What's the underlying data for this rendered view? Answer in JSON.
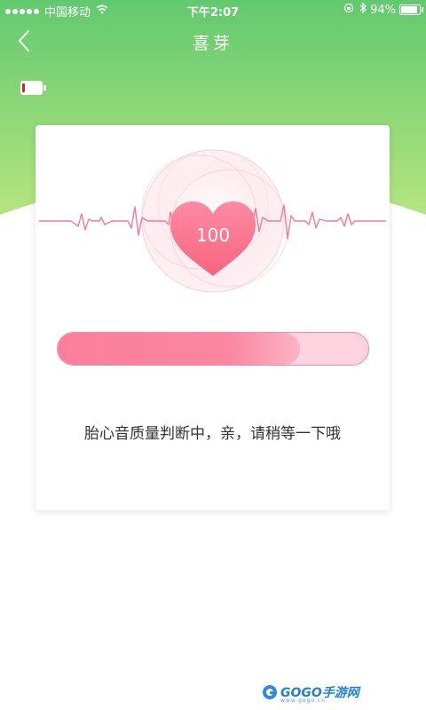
{
  "status_bar": {
    "carrier": "中国移动",
    "time": "下午2:07",
    "battery_percent": "94%",
    "icons": [
      "signal-dots",
      "wifi-icon",
      "rotation-lock-icon",
      "bluetooth-icon",
      "battery-icon"
    ]
  },
  "nav": {
    "back_icon": "chevron-left-icon",
    "title": "喜芽"
  },
  "device": {
    "battery_icon": "battery-low-icon",
    "battery_level_color": "#e2231a"
  },
  "card": {
    "heart_rate": "100",
    "progress_fraction": 0.78,
    "message": "胎心音质量判断中，亲，请稍等一下哦"
  },
  "watermark": {
    "brand": "GOGO手游网",
    "url": "www.gogo.cn"
  },
  "colors": {
    "header_green_top": "#62c96f",
    "header_green_bottom": "#b5e57f",
    "heart_pink": "#f9708f",
    "pulse_line": "#f47a96",
    "progress_pink": "#fb7f9b"
  }
}
